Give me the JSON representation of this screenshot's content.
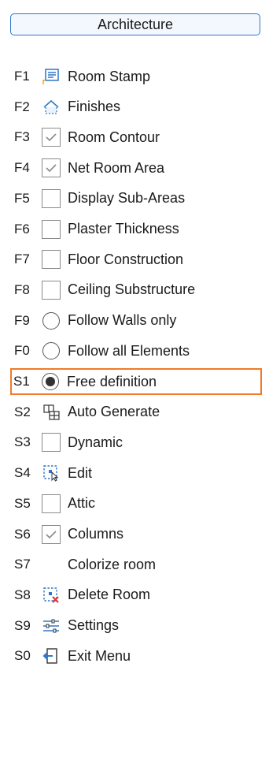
{
  "header": {
    "title": "Architecture"
  },
  "colors": {
    "accent": "#2f77c9",
    "selection_outline": "#f07b27"
  },
  "menu": [
    {
      "key": "F1",
      "label": "Room Stamp",
      "control": "icon",
      "icon": "room-stamp-icon"
    },
    {
      "key": "F2",
      "label": "Finishes",
      "control": "icon",
      "icon": "finishes-house-icon"
    },
    {
      "key": "F3",
      "label": "Room Contour",
      "control": "checkbox",
      "checked": true
    },
    {
      "key": "F4",
      "label": "Net Room Area",
      "control": "checkbox",
      "checked": true
    },
    {
      "key": "F5",
      "label": "Display Sub-Areas",
      "control": "checkbox",
      "checked": false
    },
    {
      "key": "F6",
      "label": "Plaster Thickness",
      "control": "checkbox",
      "checked": false
    },
    {
      "key": "F7",
      "label": "Floor Construction",
      "control": "checkbox",
      "checked": false
    },
    {
      "key": "F8",
      "label": "Ceiling Substructure",
      "control": "checkbox",
      "checked": false
    },
    {
      "key": "F9",
      "label": "Follow Walls only",
      "control": "radio",
      "checked": false
    },
    {
      "key": "F0",
      "label": "Follow all Elements",
      "control": "radio",
      "checked": false
    },
    {
      "key": "S1",
      "label": "Free definition",
      "control": "radio",
      "checked": true,
      "selected": true
    },
    {
      "key": "S2",
      "label": "Auto Generate",
      "control": "icon",
      "icon": "auto-generate-icon"
    },
    {
      "key": "S3",
      "label": "Dynamic",
      "control": "checkbox",
      "checked": false
    },
    {
      "key": "S4",
      "label": "Edit",
      "control": "icon",
      "icon": "edit-room-icon"
    },
    {
      "key": "S5",
      "label": "Attic",
      "control": "checkbox",
      "checked": false
    },
    {
      "key": "S6",
      "label": "Columns",
      "control": "checkbox",
      "checked": true
    },
    {
      "key": "S7",
      "label": "Colorize room",
      "control": "none"
    },
    {
      "key": "S8",
      "label": "Delete Room",
      "control": "icon",
      "icon": "delete-room-icon"
    },
    {
      "key": "S9",
      "label": "Settings",
      "control": "icon",
      "icon": "settings-sliders-icon"
    },
    {
      "key": "S0",
      "label": "Exit Menu",
      "control": "icon",
      "icon": "exit-menu-icon"
    }
  ]
}
